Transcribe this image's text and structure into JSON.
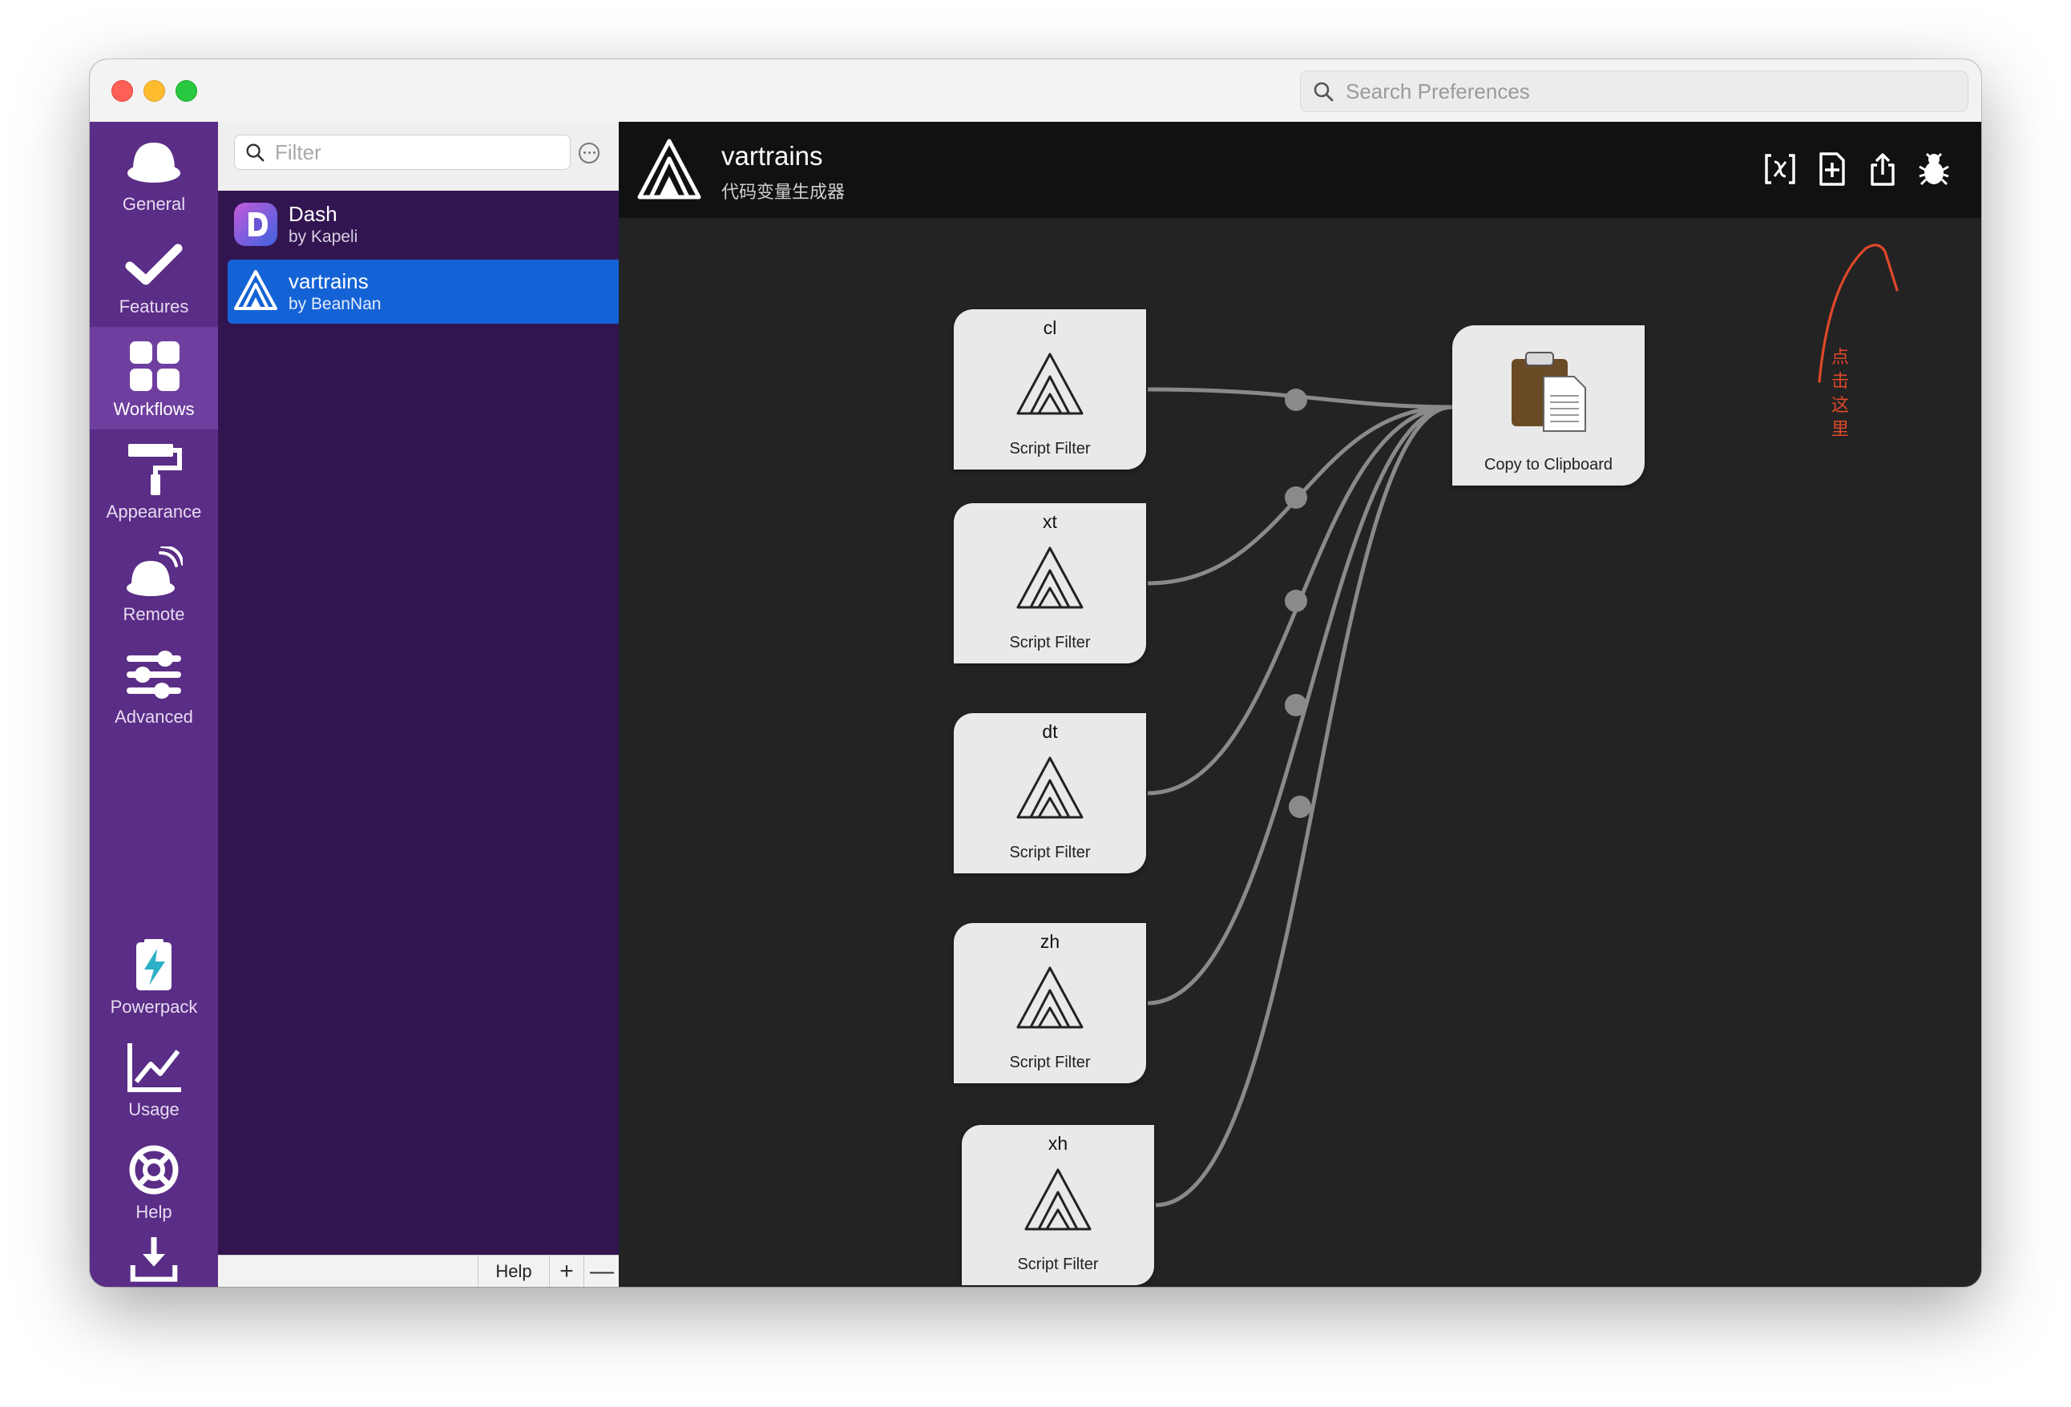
{
  "titlebar": {
    "search_placeholder": "Search Preferences"
  },
  "nav": {
    "items": [
      {
        "label": "General",
        "icon": "general-icon"
      },
      {
        "label": "Features",
        "icon": "checkmark-icon"
      },
      {
        "label": "Workflows",
        "icon": "grid-icon",
        "active": true
      },
      {
        "label": "Appearance",
        "icon": "paint-roller-icon"
      },
      {
        "label": "Remote",
        "icon": "remote-icon"
      },
      {
        "label": "Advanced",
        "icon": "sliders-icon"
      },
      {
        "label": "Powerpack",
        "icon": "battery-bolt-icon"
      },
      {
        "label": "Usage",
        "icon": "usage-chart-icon"
      },
      {
        "label": "Help",
        "icon": "lifebuoy-icon"
      },
      {
        "label": "Update",
        "icon": "download-icon"
      }
    ]
  },
  "list": {
    "filter_placeholder": "Filter",
    "workflows": [
      {
        "name": "Dash",
        "author": "by Kapeli",
        "selected": false
      },
      {
        "name": "vartrains",
        "author": "by BeanNan",
        "selected": true
      }
    ],
    "bottom": {
      "help": "Help",
      "add": "+",
      "remove": "—"
    }
  },
  "workflow": {
    "title": "vartrains",
    "subtitle": "代码变量生成器",
    "annotation": [
      "点",
      "击",
      "这",
      "里"
    ],
    "inputs": [
      {
        "keyword": "cl",
        "type": "Script Filter"
      },
      {
        "keyword": "xt",
        "type": "Script Filter"
      },
      {
        "keyword": "dt",
        "type": "Script Filter"
      },
      {
        "keyword": "zh",
        "type": "Script Filter"
      },
      {
        "keyword": "xh",
        "type": "Script Filter"
      }
    ],
    "output": {
      "type": "Copy to Clipboard"
    }
  },
  "colors": {
    "nav_bg": "#5a2d86",
    "list_bg": "#321550",
    "selection": "#1463d6",
    "canvas_bg": "#232323",
    "annotation": "#e0482a"
  }
}
